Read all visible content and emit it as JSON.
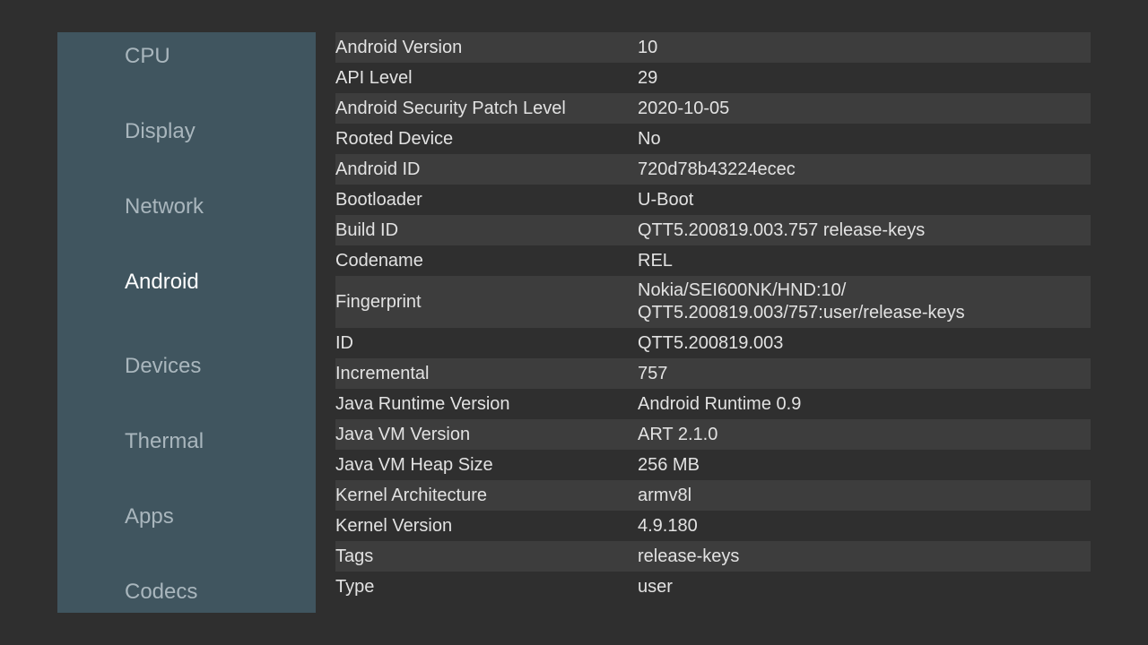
{
  "sidebar": {
    "items": [
      {
        "label": "CPU",
        "active": false
      },
      {
        "label": "Display",
        "active": false
      },
      {
        "label": "Network",
        "active": false
      },
      {
        "label": "Android",
        "active": true
      },
      {
        "label": "Devices",
        "active": false
      },
      {
        "label": "Thermal",
        "active": false
      },
      {
        "label": "Apps",
        "active": false
      },
      {
        "label": "Codecs",
        "active": false
      }
    ]
  },
  "info": {
    "rows": [
      {
        "label": "Android Version",
        "value": "10"
      },
      {
        "label": "API Level",
        "value": "29"
      },
      {
        "label": "Android Security Patch Level",
        "value": "2020-10-05"
      },
      {
        "label": "Rooted Device",
        "value": "No"
      },
      {
        "label": "Android ID",
        "value": "720d78b43224ecec"
      },
      {
        "label": "Bootloader",
        "value": "U-Boot"
      },
      {
        "label": "Build ID",
        "value": "QTT5.200819.003.757 release-keys"
      },
      {
        "label": "Codename",
        "value": "REL"
      },
      {
        "label": "Fingerprint",
        "value": "Nokia/SEI600NK/HND:10/\nQTT5.200819.003/757:user/release-keys"
      },
      {
        "label": "ID",
        "value": "QTT5.200819.003"
      },
      {
        "label": "Incremental",
        "value": "757"
      },
      {
        "label": "Java Runtime Version",
        "value": "Android Runtime 0.9"
      },
      {
        "label": "Java VM Version",
        "value": "ART 2.1.0"
      },
      {
        "label": "Java VM Heap Size",
        "value": "256 MB"
      },
      {
        "label": "Kernel Architecture",
        "value": "armv8l"
      },
      {
        "label": "Kernel Version",
        "value": "4.9.180"
      },
      {
        "label": "Tags",
        "value": "release-keys"
      },
      {
        "label": "Type",
        "value": "user"
      }
    ]
  },
  "colors": {
    "background": "#2f2f2f",
    "sidebar": "#40555f",
    "row_shade": "#3d3d3d",
    "nav_inactive": "#a9b6bd",
    "nav_active": "#ffffff",
    "text": "#e2e2e2"
  }
}
